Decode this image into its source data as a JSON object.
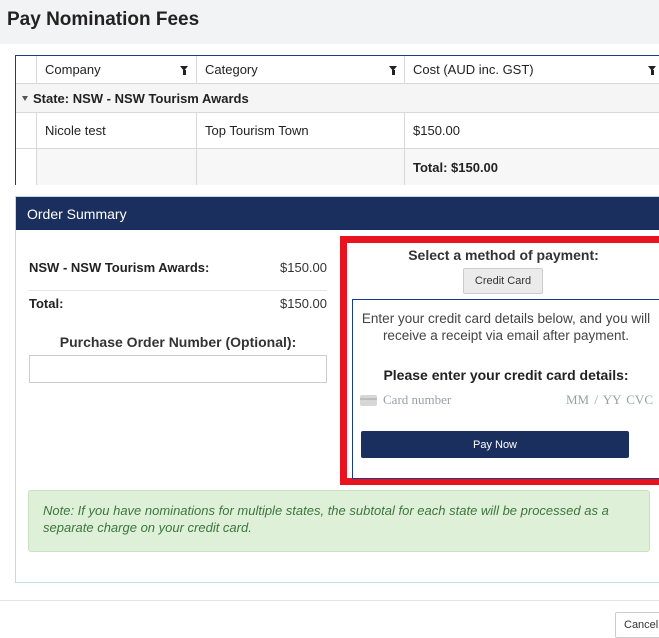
{
  "page": {
    "title": "Pay Nomination Fees"
  },
  "grid": {
    "columns": [
      "Company",
      "Category",
      "Cost (AUD inc. GST)"
    ],
    "group_label": "State: NSW - NSW Tourism  Awards",
    "rows": [
      {
        "company": "Nicole test",
        "category": "Top Tourism Town",
        "cost": "$150.00"
      }
    ],
    "total": "Total: $150.00"
  },
  "summary": {
    "header": "Order Summary",
    "lines": [
      {
        "label": "NSW - NSW Tourism  Awards:",
        "amount": "$150.00"
      },
      {
        "label": "Total:",
        "amount": "$150.00"
      }
    ],
    "po_label": "Purchase Order Number (Optional):",
    "po_value": ""
  },
  "payment": {
    "method_title": "Select a method of payment:",
    "method_button": "Credit Card",
    "instructions": "Enter your credit card details below, and you will receive a receipt via email after payment.",
    "prompt": "Please enter your credit card details:",
    "card_number_placeholder": "Card number",
    "expiry_placeholder": "MM / YY  CVC",
    "pay_button": "Pay Now"
  },
  "note": "Note: If you have nominations for multiple states, the subtotal for each state will be processed as a separate charge on your credit card.",
  "footer": {
    "cancel": "Cancel"
  },
  "colors": {
    "navy": "#1b2f5e",
    "highlight": "#e8131f",
    "note_bg": "#dff0d8",
    "note_text": "#3c763d"
  },
  "icons": [
    "filter-icon",
    "collapse-arrow-icon",
    "credit-card-icon"
  ]
}
